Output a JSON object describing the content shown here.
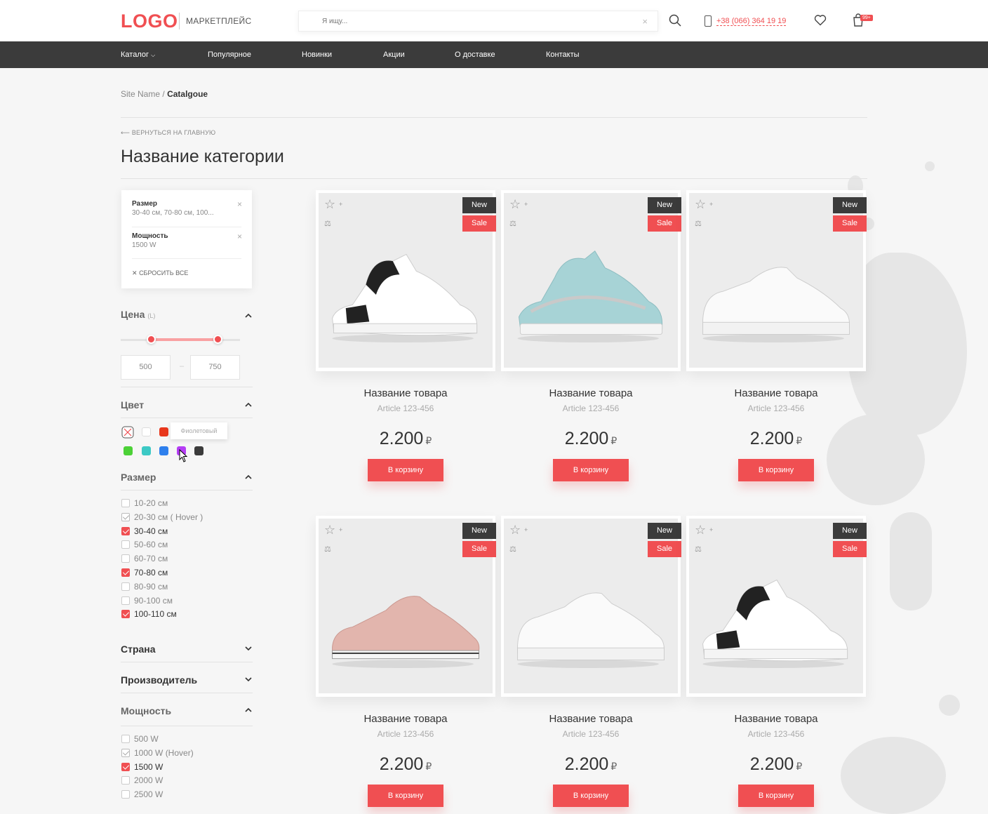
{
  "header": {
    "logo": "LOGO",
    "marketplace": "МАРКЕТПЛЕЙС",
    "search_placeholder": "Я ищу...",
    "phone": "+38 (066) 364 19 19",
    "cart_badge": "99+"
  },
  "nav": {
    "items": [
      "Каталог",
      "Популярное",
      "Новинки",
      "Акции",
      "О доставке",
      "Контакты"
    ]
  },
  "breadcrumb": {
    "site": "Site Name",
    "sep": "/",
    "current": "Catalgoue"
  },
  "back_link": "ВЕРНУТЬСЯ НА ГЛАВНУЮ",
  "page_title": "Название категории",
  "active_filters": {
    "items": [
      {
        "label": "Размер",
        "value": "30-40 см, 70-80 см, 100..."
      },
      {
        "label": "Мощность",
        "value": "1500 W"
      }
    ],
    "reset": "СБРОСИТЬ ВСЕ"
  },
  "filters": {
    "price": {
      "title": "Цена",
      "unit": "(L)",
      "min": "500",
      "max": "750",
      "range_start": 0.25,
      "range_end": 0.81
    },
    "color": {
      "title": "Цвет",
      "tooltip": "Фиолетовый",
      "swatches": [
        "#ffffff",
        "#ffffff",
        "#e8371c",
        "#4cd137",
        "#3cc9c5",
        "#2f80ed",
        "#b53df5",
        "#3b3b3b"
      ]
    },
    "size": {
      "title": "Размер",
      "options": [
        {
          "label": "10-20 см",
          "state": "off"
        },
        {
          "label": "20-30 см ( Hover )",
          "state": "hover"
        },
        {
          "label": "30-40 см",
          "state": "on"
        },
        {
          "label": "50-60 см",
          "state": "off"
        },
        {
          "label": "60-70 см",
          "state": "off"
        },
        {
          "label": "70-80 см",
          "state": "on"
        },
        {
          "label": "80-90 см",
          "state": "off"
        },
        {
          "label": "90-100 см",
          "state": "off"
        },
        {
          "label": "100-110 см",
          "state": "on"
        }
      ]
    },
    "country": {
      "title": "Страна"
    },
    "manufacturer": {
      "title": "Производитель"
    },
    "power": {
      "title": "Мощность",
      "options": [
        {
          "label": "500 W",
          "state": "off"
        },
        {
          "label": "1000 W (Hover)",
          "state": "hover"
        },
        {
          "label": "1500 W",
          "state": "on"
        },
        {
          "label": "2000 W",
          "state": "off"
        },
        {
          "label": "2500 W",
          "state": "off"
        }
      ]
    }
  },
  "products": [
    {
      "name": "Название товара",
      "article": "Article 123-456",
      "price": "2.200",
      "currency": "₽",
      "badge_new": "New",
      "badge_sale": "Sale",
      "button": "В корзину",
      "shoe": "white-black"
    },
    {
      "name": "Название товара",
      "article": "Article 123-456",
      "price": "2.200",
      "currency": "₽",
      "badge_new": "New",
      "badge_sale": "Sale",
      "button": "В корзину",
      "shoe": "blue"
    },
    {
      "name": "Название товара",
      "article": "Article 123-456",
      "price": "2.200",
      "currency": "₽",
      "badge_new": "New",
      "badge_sale": "Sale",
      "button": "В корзину",
      "shoe": "white"
    },
    {
      "name": "Название товара",
      "article": "Article 123-456",
      "price": "2.200",
      "currency": "₽",
      "badge_new": "New",
      "badge_sale": "Sale",
      "button": "В корзину",
      "shoe": "pink"
    },
    {
      "name": "Название товара",
      "article": "Article 123-456",
      "price": "2.200",
      "currency": "₽",
      "badge_new": "New",
      "badge_sale": "Sale",
      "button": "В корзину",
      "shoe": "white"
    },
    {
      "name": "Название товара",
      "article": "Article 123-456",
      "price": "2.200",
      "currency": "₽",
      "badge_new": "New",
      "badge_sale": "Sale",
      "button": "В корзину",
      "shoe": "white-black"
    }
  ],
  "colors": {
    "accent": "#f04f52",
    "dark": "#3b3b3b",
    "background": "#f6f6f6"
  }
}
